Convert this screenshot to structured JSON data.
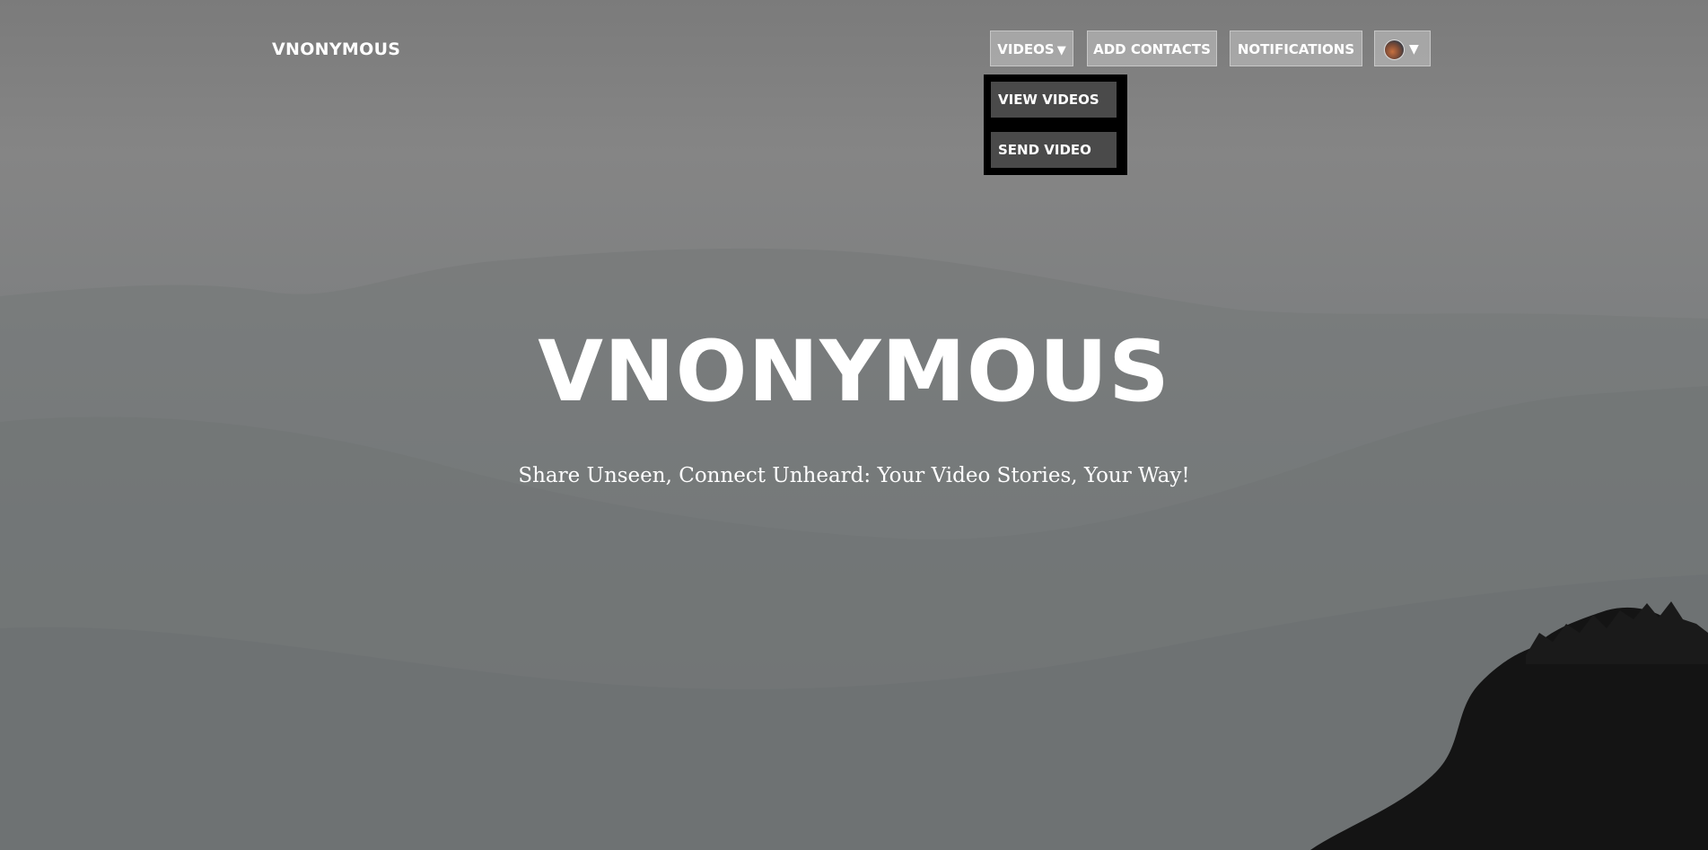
{
  "brand": {
    "name": "VNONYMOUS"
  },
  "nav": {
    "videos_label": "VIDEOS",
    "videos_caret": "▼",
    "add_contacts_label": "ADD CONTACTS",
    "notifications_label": "NOTIFICATIONS",
    "account_caret": "▼"
  },
  "videos_dropdown": {
    "items": [
      {
        "label": "VIEW VIDEOS"
      },
      {
        "label": "SEND VIDEO"
      }
    ]
  },
  "hero": {
    "title": "VNONYMOUS",
    "subtitle": "Share Unseen, Connect Unheard: Your Video Stories, Your Way!"
  },
  "icons": {
    "account": "avatar-icon",
    "caret": "caret-down-icon"
  },
  "colors": {
    "dropdown_bg": "#000000",
    "dropdown_item_bg": "#4a4a4a",
    "nav_button_bg": "#b4b4b4",
    "text": "#ffffff"
  }
}
